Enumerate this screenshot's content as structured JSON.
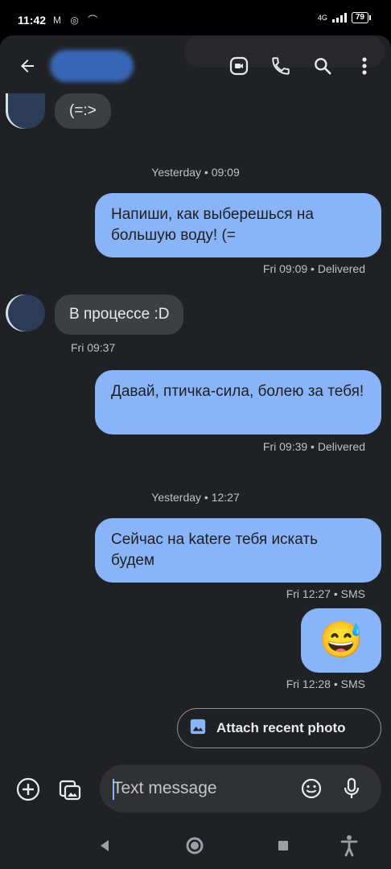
{
  "status_bar": {
    "time": "11:42",
    "left_icons": "M ◎ ⌒",
    "signal_label": "4G",
    "battery": "79"
  },
  "header": {
    "contact_name": ""
  },
  "messages": [
    {
      "direction": "in",
      "text": "(=:>"
    },
    {
      "type": "date",
      "text": "Yesterday • 09:09"
    },
    {
      "direction": "out",
      "text": "Напиши, как выберешься на большую воду! (=",
      "meta": "Fri 09:09 • Delivered"
    },
    {
      "direction": "in",
      "text": "В процессе :D",
      "meta": "Fri 09:37"
    },
    {
      "direction": "out",
      "text": "Давай, птичка-сила, болею за тебя!",
      "meta": "Fri 09:39 • Delivered"
    },
    {
      "type": "date",
      "text": "Yesterday • 12:27"
    },
    {
      "direction": "out",
      "text": "Сейчас на katere тебя искать будем",
      "meta": "Fri 12:27 • SMS"
    },
    {
      "direction": "out",
      "text": "😅",
      "meta": "Fri 12:28 • SMS"
    }
  ],
  "attach": {
    "label": "Attach recent photo"
  },
  "compose": {
    "placeholder": "Text message"
  },
  "colors": {
    "background": "#202124",
    "outgoing_bubble": "#8ab4f8",
    "incoming_bubble": "#3c4043",
    "meta_text": "#bdc1c6"
  },
  "icons": {
    "header": [
      "back-arrow-icon",
      "video-call-icon",
      "phone-icon",
      "search-icon",
      "more-vert-icon"
    ],
    "compose": [
      "add-circle-icon",
      "gallery-icon",
      "emoji-icon",
      "mic-icon"
    ],
    "nav": [
      "nav-back-icon",
      "nav-home-icon",
      "nav-recents-icon",
      "accessibility-icon"
    ]
  }
}
